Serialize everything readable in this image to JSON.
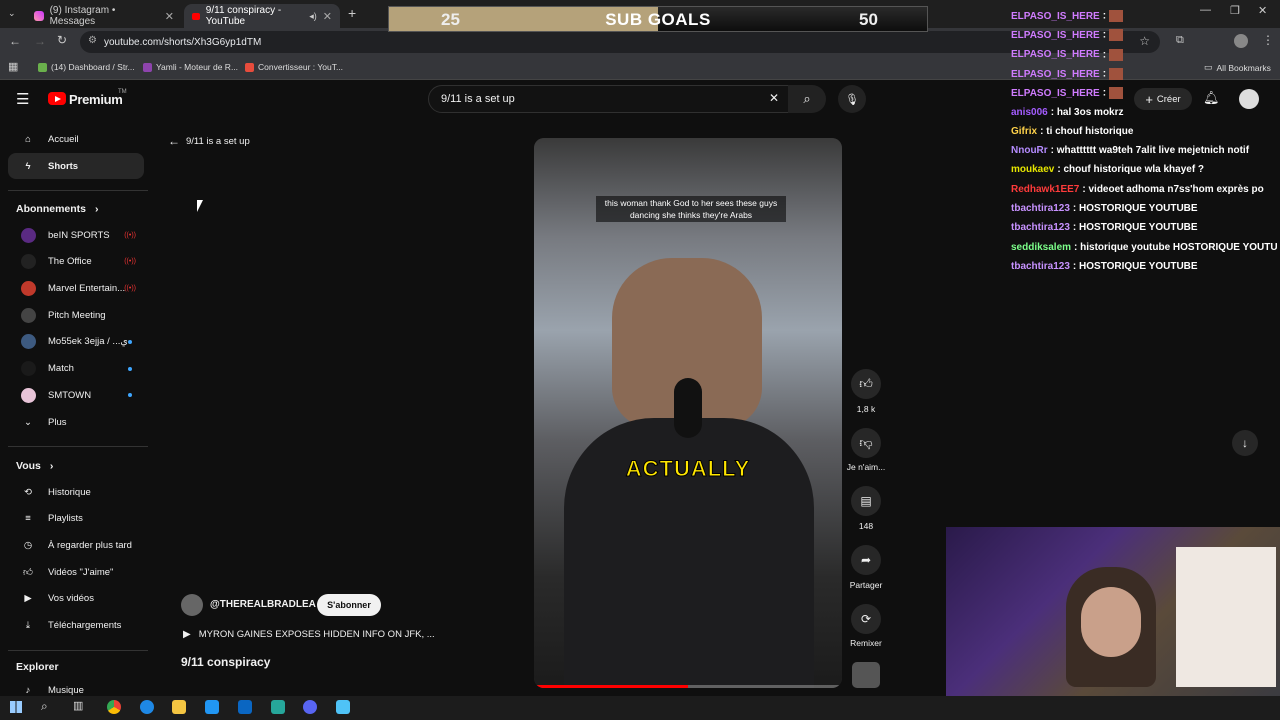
{
  "browser": {
    "tabs": [
      {
        "title": "(9) Instagram • Messages",
        "active": false
      },
      {
        "title": "9/11 conspiracy - YouTube",
        "active": true
      }
    ],
    "url": "youtube.com/shorts/Xh3G6yp1dTM",
    "bookmarks": [
      {
        "label": "(14) Dashboard / Str...",
        "color": "#6ab04c"
      },
      {
        "label": "Yamli - Moteur de R...",
        "color": "#8e44ad"
      },
      {
        "label": "Convertisseur : YouT...",
        "color": "#e74c3c"
      }
    ],
    "all_bookmarks": "All Bookmarks"
  },
  "overlay": {
    "sub_goals_label": "SUB GOALS",
    "current": "25",
    "target": "50",
    "progress_fraction": 0.5,
    "progress_color": "#b5a27a"
  },
  "youtube": {
    "logo_text": "Premium",
    "logo_superscript": "TM",
    "search_value": "9/11 is a set up",
    "create_label": "Créer",
    "back_label": "9/11 is a set up",
    "sidebar": {
      "main": [
        {
          "label": "Accueil",
          "icon": "home-icon"
        },
        {
          "label": "Shorts",
          "icon": "shorts-icon",
          "active": true
        }
      ],
      "subscriptions_title": "Abonnements",
      "subscriptions": [
        {
          "label": "beIN SPORTS",
          "color": "#5a2a82",
          "status": "live"
        },
        {
          "label": "The Office",
          "color": "#222222",
          "status": "live"
        },
        {
          "label": "Marvel Entertain...",
          "color": "#c0392b",
          "status": "live"
        },
        {
          "label": "Pitch Meeting",
          "color": "#444444",
          "status": ""
        },
        {
          "label": "Mo55ek 3ejja / ...ي",
          "color": "#3d5a80",
          "status": "new"
        },
        {
          "label": "Match",
          "color": "#1a1a1a",
          "status": "new"
        },
        {
          "label": "SMTOWN",
          "color": "#e8c4d8",
          "status": "new"
        }
      ],
      "more_label": "Plus",
      "you_title": "Vous",
      "you_items": [
        {
          "label": "Historique",
          "icon": "history-icon"
        },
        {
          "label": "Playlists",
          "icon": "playlists-icon"
        },
        {
          "label": "À regarder plus tard",
          "icon": "watch-later-icon"
        },
        {
          "label": "Vidéos \"J'aime\"",
          "icon": "like-icon"
        },
        {
          "label": "Vos vidéos",
          "icon": "your-videos-icon"
        },
        {
          "label": "Téléchargements",
          "icon": "download-icon"
        }
      ],
      "explore_title": "Explorer",
      "explore_items": [
        {
          "label": "Musique",
          "icon": "music-icon"
        }
      ]
    },
    "short": {
      "caption_top": "this woman thank God to her sees these guys dancing she thinks they're Arabs",
      "caption_big": "ACTUALLY",
      "channel": "@THEREALBRADLEA",
      "subscribe_label": "S'abonner",
      "music_line": "MYRON GAINES EXPOSES HIDDEN INFO ON JFK, ...",
      "title": "9/11 conspiracy"
    },
    "actions": {
      "likes": "1,8 k",
      "dislike_label": "Je n'aim...",
      "comments": "148",
      "share_label": "Partager",
      "remix_label": "Remixer"
    }
  },
  "chat": [
    {
      "user": "ELPASO_IS_HERE",
      "text": "",
      "color": "#d07cff",
      "emote": true
    },
    {
      "user": "ELPASO_IS_HERE",
      "text": "",
      "color": "#d07cff",
      "emote": true
    },
    {
      "user": "ELPASO_IS_HERE",
      "text": "",
      "color": "#d07cff",
      "emote": true
    },
    {
      "user": "ELPASO_IS_HERE",
      "text": "",
      "color": "#d07cff",
      "emote": true
    },
    {
      "user": "ELPASO_IS_HERE",
      "text": "",
      "color": "#d07cff",
      "emote": true
    },
    {
      "user": "anis006",
      "text": "hal 3os mokrz",
      "color": "#a45cff",
      "emote": false
    },
    {
      "user": "Gifrix",
      "text": "ti chouf historique",
      "color": "#ffd24a",
      "emote": false
    },
    {
      "user": "NnouRr",
      "text": "whatttttt wa9teh 7alit live mejetnich notif",
      "color": "#b58cff",
      "emote": false
    },
    {
      "user": "moukaev",
      "text": "chouf historique wla khayef ?",
      "color": "#e6e600",
      "emote": false
    },
    {
      "user": "Redhawk1EE7",
      "text": "videoet adhoma n7ss'hom exprès po",
      "color": "#ff3b3b",
      "emote": false
    },
    {
      "user": "tbachtira123",
      "text": "HOSTORIQUE YOUTUBE",
      "color": "#c792ff",
      "emote": false
    },
    {
      "user": "tbachtira123",
      "text": "HOSTORIQUE YOUTUBE",
      "color": "#c792ff",
      "emote": false
    },
    {
      "user": "seddiksalem",
      "text": "historique youtube HOSTORIQUE YOUTU",
      "color": "#7cff8a",
      "emote": false
    },
    {
      "user": "tbachtira123",
      "text": "HOSTORIQUE YOUTUBE",
      "color": "#c792ff",
      "emote": false
    }
  ]
}
